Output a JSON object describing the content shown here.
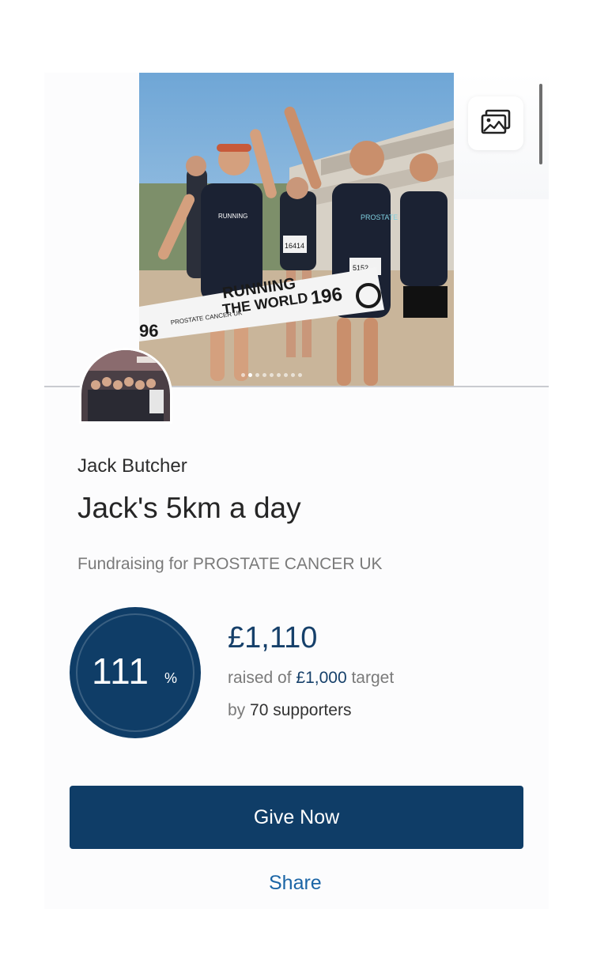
{
  "hero": {
    "banner_line1": "RUNNING",
    "banner_line2": "THE WORLD",
    "banner_number": "196",
    "banner_left_number": "96",
    "banner_charity": "PROSTATE CANCER UK",
    "shirt_left": "RUNNING",
    "shirt_right": "PROSTATE CANCER",
    "bib_1": "16414",
    "bib_2": "5152",
    "slide_count": 9,
    "active_slide": 1
  },
  "icons": {
    "gallery": "gallery-icon"
  },
  "campaign": {
    "owner": "Jack Butcher",
    "title": "Jack's 5km a day",
    "charity": "Fundraising for PROSTATE CANCER UK"
  },
  "progress": {
    "percent": "111",
    "percent_symbol": "%",
    "raised": "£1,110",
    "raised_prefix": "raised of",
    "target": "£1,000",
    "target_suffix": "target",
    "by_prefix": "by",
    "supporters": "70 supporters"
  },
  "actions": {
    "give_label": "Give Now",
    "share_label": "Share"
  },
  "colors": {
    "brand": "#0f3d67",
    "link": "#1b65a6",
    "muted": "#7a7a7a"
  }
}
